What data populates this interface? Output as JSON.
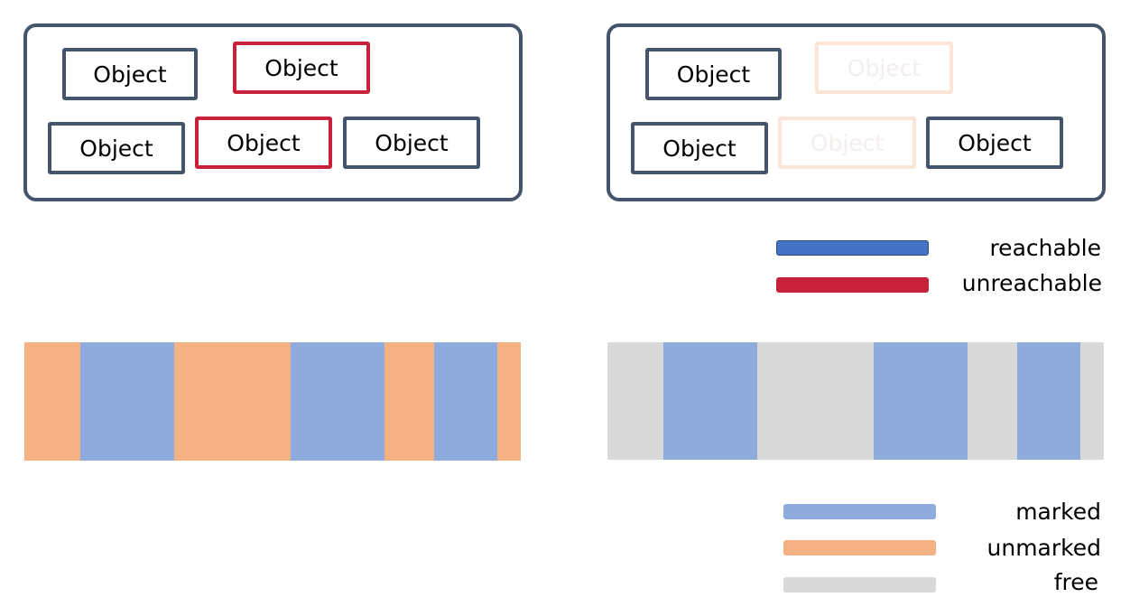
{
  "object_label": "Object",
  "legend_reachability": {
    "reachable": {
      "label": "reachable",
      "color": "#4472c4"
    },
    "unreachable": {
      "label": "unreachable",
      "color": "#c8223a"
    }
  },
  "legend_marking": {
    "marked": {
      "label": "marked",
      "color": "#8faadc"
    },
    "unmarked": {
      "label": "unmarked",
      "color": "#f4b183"
    },
    "free": {
      "label": "free",
      "color": "#d9d9d9"
    }
  },
  "heap_left": [
    "unmarked",
    "marked",
    "unmarked",
    "marked",
    "unmarked",
    "marked",
    "unmarked"
  ],
  "heap_right": [
    "free",
    "marked",
    "free",
    "marked",
    "free",
    "marked",
    "free"
  ],
  "colors": {
    "panel_border": "#44546a",
    "freed_border": "#fbe5d6"
  }
}
